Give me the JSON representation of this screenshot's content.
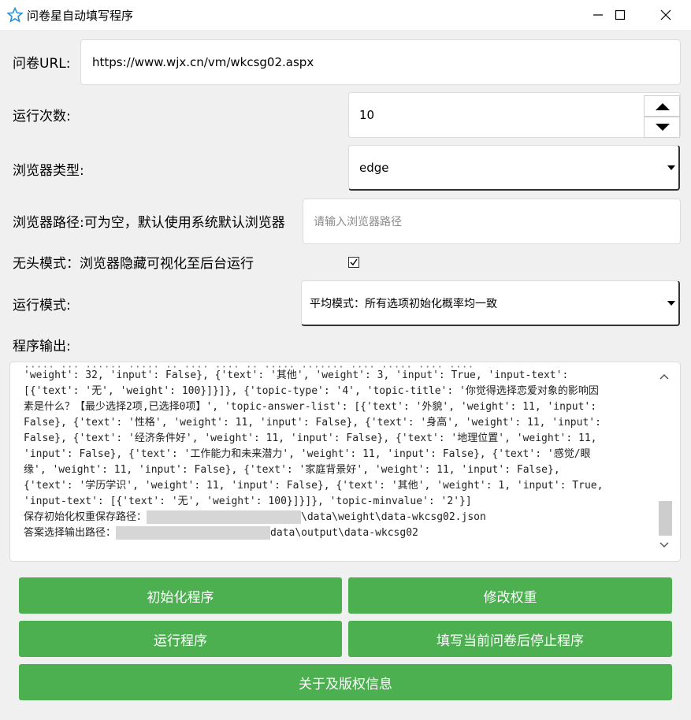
{
  "window": {
    "title": "问卷星自动填写程序",
    "app_icon": "star-icon",
    "controls": {
      "minimize": "minimize-icon",
      "maximize": "maximize-icon",
      "close": "close-icon"
    }
  },
  "form": {
    "url_label": "问卷URL:",
    "url_value": "https://www.wjx.cn/vm/wkcsg02.aspx",
    "runs_label": "运行次数:",
    "runs_value": "10",
    "browser_type_label": "浏览器类型:",
    "browser_type_value": "edge",
    "browser_path_label": "浏览器路径:可为空，默认使用系统默认浏览器",
    "browser_path_placeholder": "请输入浏览器路径",
    "headless_label": "无头模式：浏览器隐藏可视化至后台运行",
    "headless_checked": true,
    "run_mode_label": "运行模式:",
    "run_mode_value": "平均模式：所有选项初始化概率均一致",
    "output_label": "程序输出:"
  },
  "output": {
    "lines": [
      "'weight': 32, 'input': False}, {'text': '其他', 'weight': 3, 'input': True, 'input-text':",
      "[{'text': '无', 'weight': 100}]}]}, {'topic-type': '4', 'topic-title': '你觉得选择恋爱对象的影响因",
      "素是什么？【最少选择2项,已选择0项】', 'topic-answer-list': [{'text': '外貌', 'weight': 11, 'input':",
      "False}, {'text': '性格', 'weight': 11, 'input': False}, {'text': '身高', 'weight': 11, 'input':",
      "False}, {'text': '经济条件好', 'weight': 11, 'input': False}, {'text': '地理位置', 'weight': 11,",
      "'input': False}, {'text': '工作能力和未来潜力', 'weight': 11, 'input': False}, {'text': '感觉/眼",
      "缘', 'weight': 11, 'input': False}, {'text': '家庭背景好', 'weight': 11, 'input': False},",
      "{'text': '学历学识', 'weight': 11, 'input': False}, {'text': '其他', 'weight': 1, 'input': True,",
      "'input-text': [{'text': '无', 'weight': 100}]}]}, 'topic-minvalue': '2'}]"
    ],
    "save_weights_label": "保存初始化权重保存路径：",
    "save_weights_suffix": "\\data\\weight\\data-wkcsg02.json",
    "answer_output_label": "答案选择输出路径：",
    "answer_output_suffix": "data\\output\\data-wkcsg02"
  },
  "buttons": {
    "init": "初始化程序",
    "modify_weights": "修改权重",
    "run": "运行程序",
    "stop_after_current": "填写当前问卷后停止程序",
    "about": "关于及版权信息"
  },
  "colors": {
    "button_green": "#4caf50",
    "window_bg": "#f0f0f0"
  }
}
